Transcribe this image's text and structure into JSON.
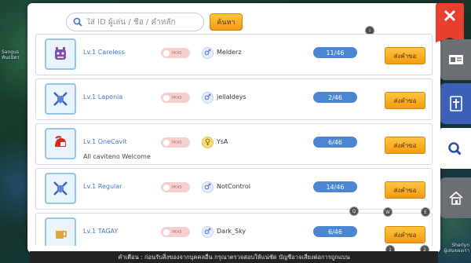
{
  "search": {
    "placeholder": "ใส่ ID ผู้เล่น / ชื่อ / คำหลัก",
    "button_label": "ค้นหา"
  },
  "guilds": [
    {
      "name": "Lv.1 Careless",
      "description": "",
      "pk_label": "PK45",
      "leader_gender": "male",
      "gender_symbol": "♂",
      "leader": "Melderz",
      "members": "11/46",
      "join_label": "ส่งคำขอ",
      "emblem": "purple-creature-icon"
    },
    {
      "name": "Lv.1 Laponia",
      "description": "",
      "pk_label": "PK45",
      "leader_gender": "male",
      "gender_symbol": "♂",
      "leader": "jellaldeys",
      "members": "2/46",
      "join_label": "ส่งคำขอ",
      "emblem": "crossed-swords-shield-icon"
    },
    {
      "name": "Lv.1 OneCavit",
      "description": "All caviteno Welcome",
      "pk_label": "PK45",
      "leader_gender": "female",
      "gender_symbol": "♀",
      "leader": "YsA",
      "members": "6/46",
      "join_label": "ส่งคำขอ",
      "emblem": "red-helmet-icon"
    },
    {
      "name": "Lv.1 Regular",
      "description": "",
      "pk_label": "PK45",
      "leader_gender": "male",
      "gender_symbol": "♂",
      "leader": "NotControl",
      "members": "14/46",
      "join_label": "ส่งคำขอ",
      "emblem": "crossed-swords-shield-icon"
    },
    {
      "name": "Lv.1 TAGAY",
      "description": "",
      "pk_label": "PK45",
      "leader_gender": "male",
      "gender_symbol": "♂",
      "leader": "Dark_Sky",
      "members": "6/46",
      "join_label": "ส่งคำขอ",
      "emblem": "beer-mug-icon"
    }
  ],
  "hud": {
    "marker_i": "I",
    "key_q": "Q",
    "key_w": "W",
    "key_e": "E",
    "slot_1": "1",
    "slot_2": "2"
  },
  "ticker": "คำเตือน : ก่อนรับสิ่งของจากบุคคลอื่น กรุณาตรวจสอบให้แน่ชัด บัญชีอาจเสี่ยงต่อการถูกแบน",
  "background": {
    "left_name": "Sangus",
    "left_tag": "พันธมิตร",
    "right_name": "Sherlyn",
    "right_tag": "ผู้เล่นของเรา"
  },
  "colors": {
    "accent_orange": "#f39a12",
    "close_red": "#e8402e",
    "count_blue": "#4a86d2",
    "guild_name_blue": "#3a78c6"
  }
}
